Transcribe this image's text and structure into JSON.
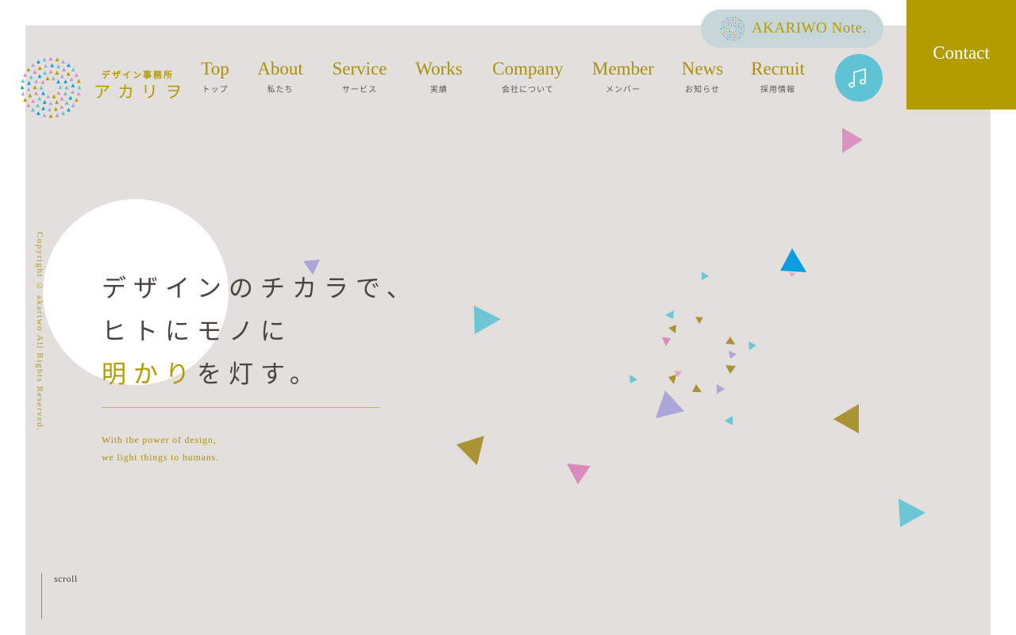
{
  "brand": {
    "subtitle": "デザイン事務所",
    "name": "アカリヲ",
    "accent_color": "#b39c00",
    "logo_icon": "sunburst-dots-icon"
  },
  "nav": [
    {
      "en": "Top",
      "jp": "トップ"
    },
    {
      "en": "About",
      "jp": "私たち"
    },
    {
      "en": "Service",
      "jp": "サービス"
    },
    {
      "en": "Works",
      "jp": "実績"
    },
    {
      "en": "Company",
      "jp": "会社について"
    },
    {
      "en": "Member",
      "jp": "メンバー"
    },
    {
      "en": "News",
      "jp": "お知らせ"
    },
    {
      "en": "Recruit",
      "jp": "採用情報"
    }
  ],
  "note_button": {
    "label": "AKARIWO Note."
  },
  "music_button": {
    "icon": "music-note-icon",
    "color": "#5fc3d3"
  },
  "contact_button": {
    "label": "Contact"
  },
  "copyright": "Copyright © akariwo All Rights Reserved.",
  "hero": {
    "line1": "デザインのチカラで、",
    "line2": "ヒトにモノに",
    "line3_highlight": "明かり",
    "line3_rest": "を灯す。",
    "tagline_line1": "With the power of design,",
    "tagline_line2": "we light things to humans."
  },
  "scroll": {
    "label": "scroll"
  },
  "colors": {
    "background": "#e2dfdd",
    "gold": "#b39c00",
    "cyan": "#5fc3d3",
    "blue": "#0a9ee0",
    "pink": "#d98bbd",
    "lavender": "#aca5d9",
    "olive": "#a99332"
  }
}
